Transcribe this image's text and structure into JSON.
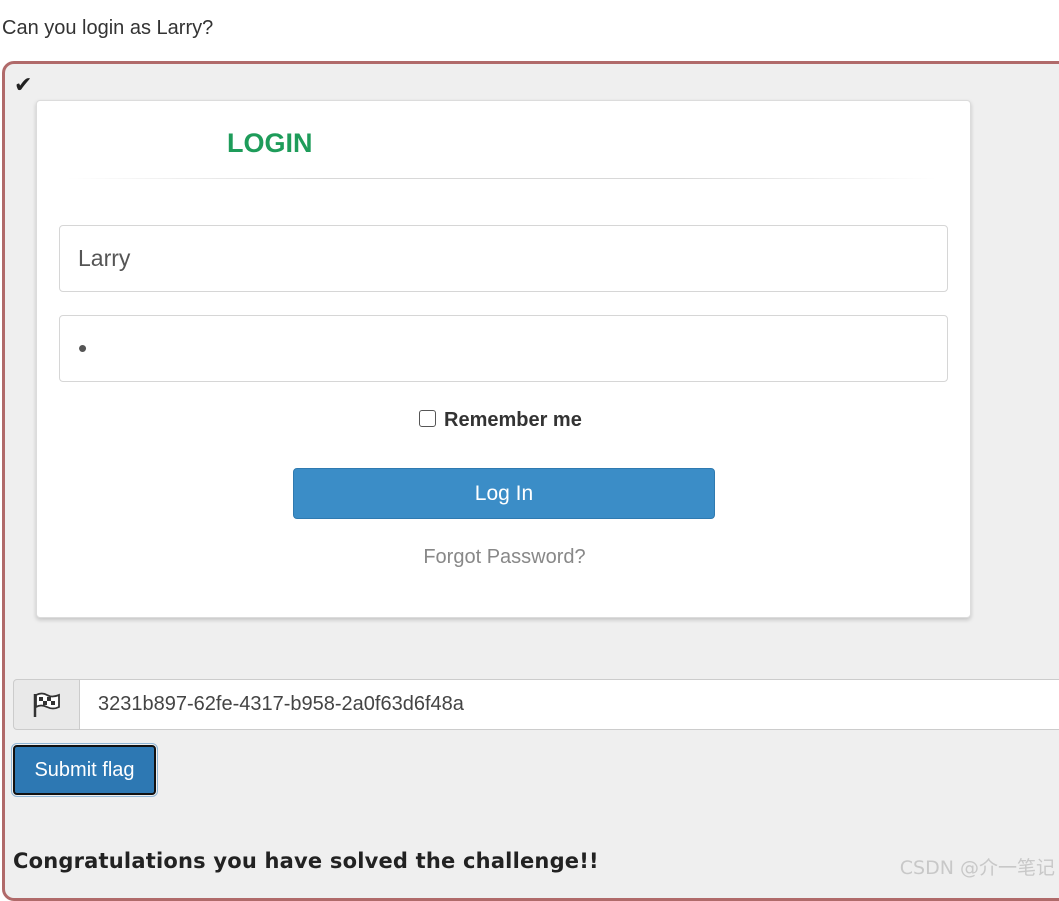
{
  "question": "Can you login as Larry?",
  "panel": {
    "check_icon": "check-icon"
  },
  "login": {
    "title": "LOGIN",
    "title_color": "#1e9c5a",
    "username_value": "Larry",
    "password_value": "•",
    "remember_label": "Remember me",
    "remember_checked": false,
    "login_button_label": "Log In",
    "button_color": "#3b8dc7",
    "forgot_label": "Forgot Password?"
  },
  "flag": {
    "icon": "flag-icon",
    "value": "3231b897-62fe-4317-b958-2a0f63d6f48a",
    "submit_label": "Submit flag"
  },
  "result": {
    "message": "Congratulations you have solved the challenge!!"
  },
  "watermark": "CSDN @介一笔记"
}
